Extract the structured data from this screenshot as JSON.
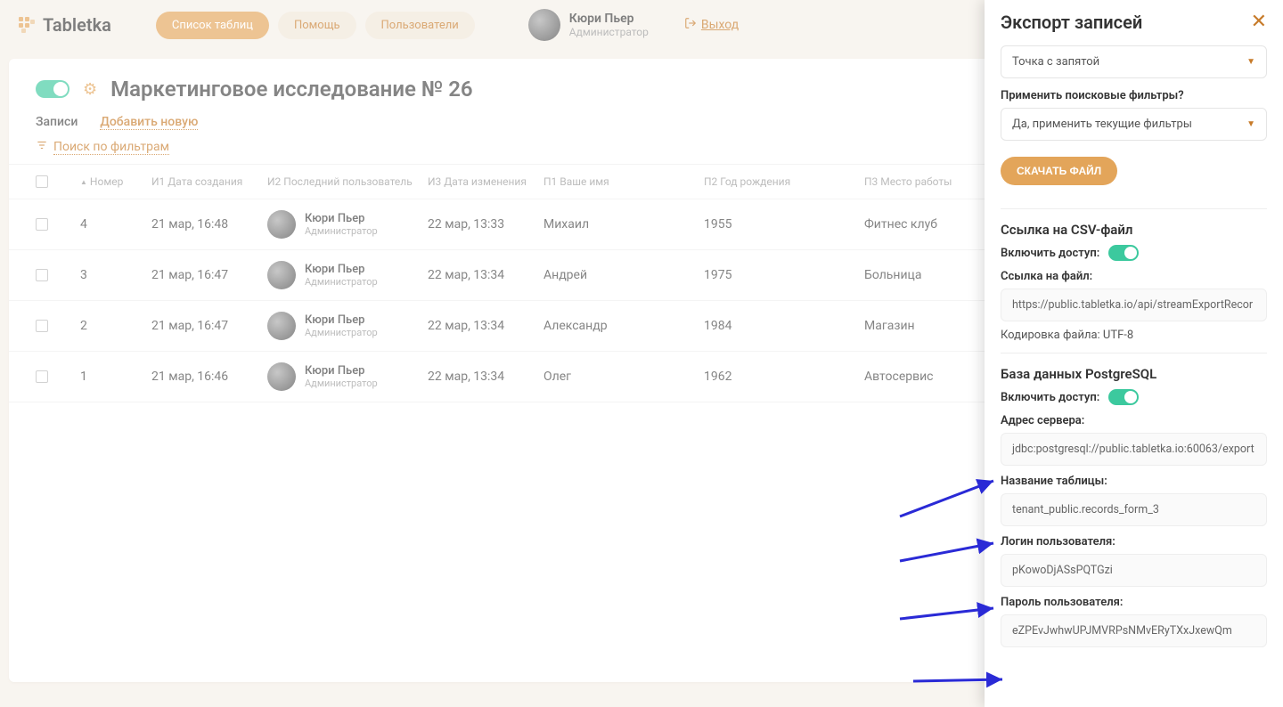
{
  "header": {
    "logo_text": "Tabletka",
    "nav": [
      "Список таблиц",
      "Помощь",
      "Пользователи"
    ],
    "user_name": "Кюри Пьер",
    "user_role": "Администратор",
    "logout": "Выход"
  },
  "page": {
    "title": "Маркетинговое исследование № 26",
    "tab_records": "Записи",
    "tab_add": "Добавить новую",
    "filter_label": "Поиск по фильтрам"
  },
  "table": {
    "headers": {
      "number": "Номер",
      "created": "И1 Дата создания",
      "user": "И2 Последний пользователь",
      "modified": "И3 Дата изменения",
      "name": "П1 Ваше имя",
      "birth": "П2 Год рождения",
      "work": "П3 Место работы"
    },
    "rows": [
      {
        "num": "4",
        "created": "21 мар, 16:48",
        "uname": "Кюри Пьер",
        "urole": "Администратор",
        "mod": "22 мар, 13:33",
        "name": "Михаил",
        "birth": "1955",
        "work": "Фитнес клуб"
      },
      {
        "num": "3",
        "created": "21 мар, 16:47",
        "uname": "Кюри Пьер",
        "urole": "Администратор",
        "mod": "22 мар, 13:34",
        "name": "Андрей",
        "birth": "1975",
        "work": "Больница"
      },
      {
        "num": "2",
        "created": "21 мар, 16:47",
        "uname": "Кюри Пьер",
        "urole": "Администратор",
        "mod": "22 мар, 13:34",
        "name": "Александр",
        "birth": "1984",
        "work": "Магазин"
      },
      {
        "num": "1",
        "created": "21 мар, 16:46",
        "uname": "Кюри Пьер",
        "urole": "Администратор",
        "mod": "22 мар, 13:34",
        "name": "Олег",
        "birth": "1962",
        "work": "Автосервис"
      }
    ]
  },
  "panel": {
    "title": "Экспорт записей",
    "separator_value": "Точка с запятой",
    "filters_label": "Применить поисковые фильтры?",
    "filters_value": "Да, применить текущие фильтры",
    "download_btn": "СКАЧАТЬ ФАЙЛ",
    "csv_header": "Ссылка на CSV-файл",
    "access_label": "Включить доступ:",
    "file_link_label": "Ссылка на файл:",
    "file_link_value": "https://public.tabletka.io/api/streamExportRecor",
    "encoding_label": "Кодировка файла: UTF-8",
    "pg_header": "База данных PostgreSQL",
    "server_label": "Адрес сервера:",
    "server_value": "jdbc:postgresql://public.tabletka.io:60063/export",
    "table_label": "Название таблицы:",
    "table_value": "tenant_public.records_form_3",
    "login_label": "Логин пользователя:",
    "login_value": "pKowoDjASsPQTGzi",
    "password_label": "Пароль пользователя:",
    "password_value": "eZPEvJwhwUPJMVRPsNMvERyTXxJxewQm"
  }
}
